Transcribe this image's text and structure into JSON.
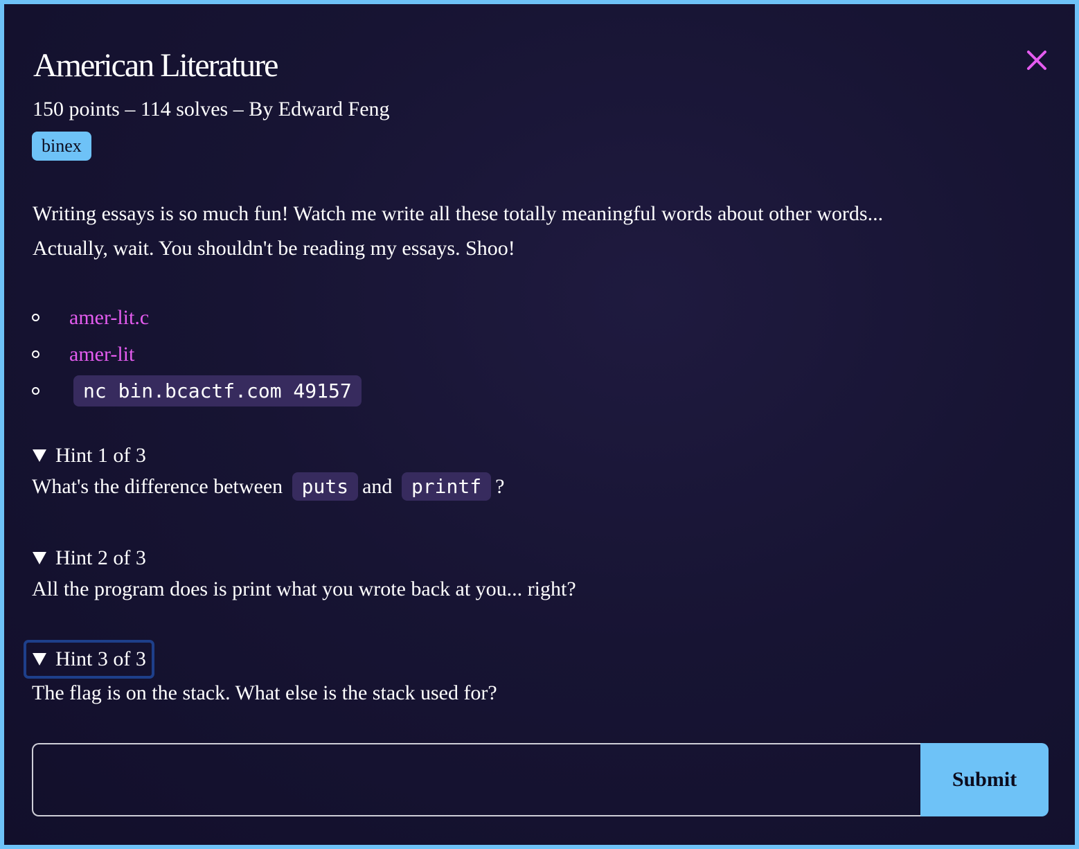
{
  "challenge": {
    "title": "American Literature",
    "meta": "150 points – 114 solves – By Edward Feng",
    "tag": "binex",
    "description": [
      "Writing essays is so much fun! Watch me write all these totally meaningful words about other words...",
      "Actually, wait. You shouldn't be reading my essays. Shoo!"
    ],
    "files": [
      {
        "label": "amer-lit.c"
      },
      {
        "label": "amer-lit"
      }
    ],
    "connection": "nc bin.bcactf.com 49157"
  },
  "hints": [
    {
      "summary": "Hint 1 of 3",
      "text_before": "What's the difference between",
      "code1": "puts",
      "text_middle": "and",
      "code2": "printf",
      "text_after": "?"
    },
    {
      "summary": "Hint 2 of 3",
      "text": "All the program does is print what you wrote back at you... right?"
    },
    {
      "summary": "Hint 3 of 3",
      "text": "The flag is on the stack. What else is the stack used for?"
    }
  ],
  "form": {
    "input_value": "",
    "input_placeholder": "",
    "submit_label": "Submit"
  },
  "colors": {
    "accent": "#6ec2f7",
    "link": "#e55cf0",
    "close": "#e55cf0",
    "code_bg": "#372b5e",
    "focus_outline": "#1e3f8a"
  },
  "icons": {
    "close": "close-icon",
    "disclosure": "triangle-down-icon",
    "bullet": "circle-bullet-icon"
  }
}
